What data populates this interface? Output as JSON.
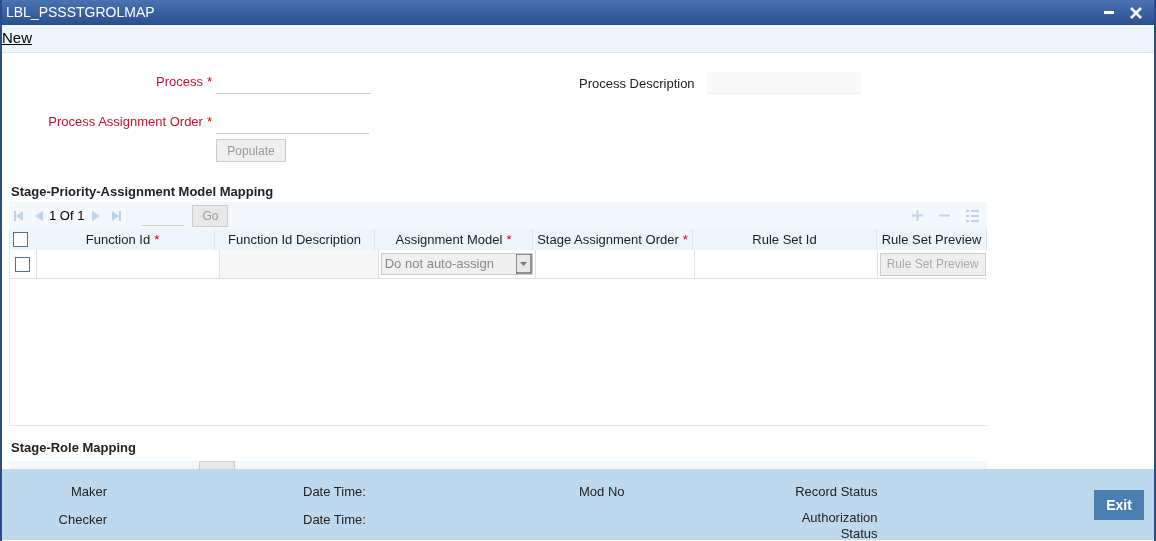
{
  "window": {
    "title": "LBL_PSSSTGROLMAP"
  },
  "menu": [
    {
      "label": "New"
    }
  ],
  "required_mark": "*",
  "form": {
    "process": {
      "label": "Process",
      "required": true
    },
    "process_description": {
      "label": "Process Description"
    },
    "assignment_order": {
      "label": "Process Assignment Order",
      "required": true
    },
    "populate_button": {
      "label": "Populate",
      "disabled": true
    }
  },
  "grid": {
    "title": "Stage-Priority-Assignment Model Mapping",
    "all_checked": false,
    "pager": {
      "page": "1",
      "of": "Of",
      "total": "1",
      "go": "Go"
    },
    "columns": [
      {
        "label": "Function Id",
        "required": true
      },
      {
        "label": "Function Id Description",
        "required": false
      },
      {
        "label": "Assignment Model",
        "required": true
      },
      {
        "label": "Stage Assignment Order",
        "required": true
      },
      {
        "label": "Rule Set Id",
        "required": false
      },
      {
        "label": "Rule Set Preview",
        "required": false
      }
    ],
    "rows": [
      {
        "checked": false,
        "assignment_model": "Do not auto-assign",
        "preview_button": "Rule Set Preview"
      }
    ]
  },
  "role_section": {
    "title": "Stage-Role Mapping"
  },
  "footer": {
    "left": [
      {
        "label": "Maker",
        "value_label": "Date Time:"
      },
      {
        "label": "Checker",
        "value_label": "Date Time:"
      }
    ],
    "mod_no": "Mod No",
    "record_status": "Record Status",
    "authorization_status": "Authorization Status",
    "exit": "Exit"
  }
}
